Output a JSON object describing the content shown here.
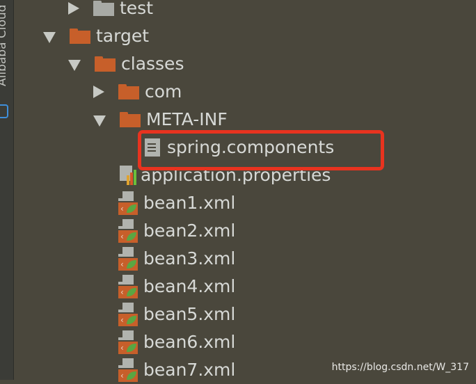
{
  "sidebar": {
    "label": "Alibaba Cloud"
  },
  "tree": {
    "test": "test",
    "target": "target",
    "classes": "classes",
    "com": "com",
    "meta_inf": "META-INF",
    "spring_components": "spring.components",
    "application_properties": "application.properties",
    "beans": [
      "bean1.xml",
      "bean2.xml",
      "bean3.xml",
      "bean4.xml",
      "bean5.xml",
      "bean6.xml",
      "bean7.xml"
    ]
  },
  "watermark": "https://blog.csdn.net/W_317",
  "colors": {
    "highlight": "#e8331f",
    "folder": "#c75f2a",
    "background": "#4a473c"
  }
}
